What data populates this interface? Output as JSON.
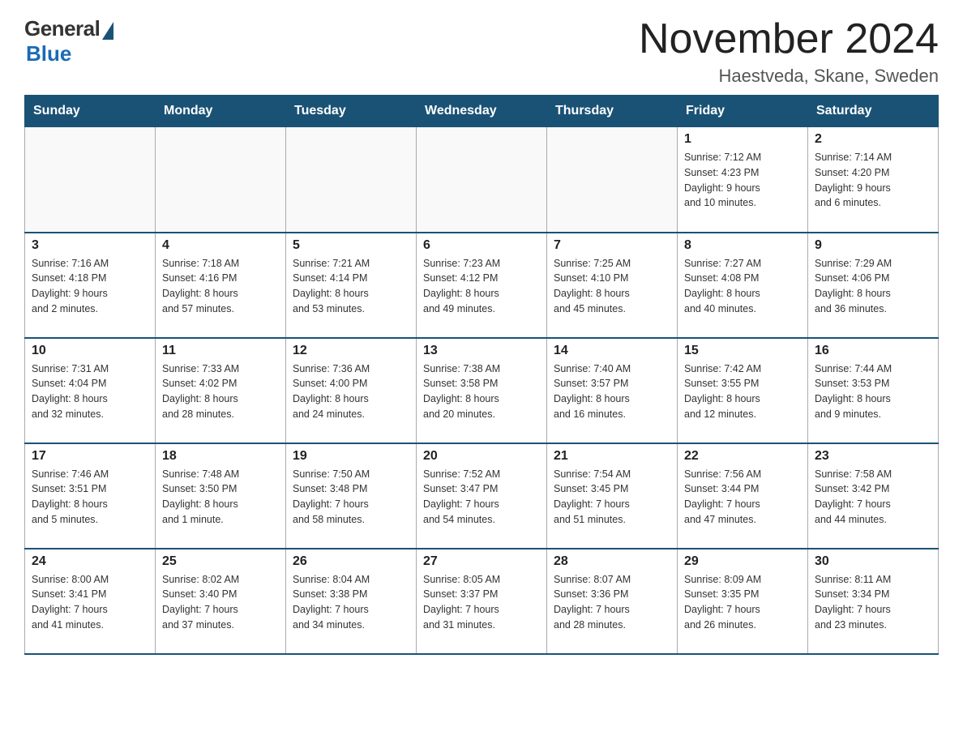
{
  "header": {
    "logo_general": "General",
    "logo_blue": "Blue",
    "month_year": "November 2024",
    "location": "Haestveda, Skane, Sweden"
  },
  "weekdays": [
    "Sunday",
    "Monday",
    "Tuesday",
    "Wednesday",
    "Thursday",
    "Friday",
    "Saturday"
  ],
  "weeks": [
    [
      {
        "day": "",
        "info": ""
      },
      {
        "day": "",
        "info": ""
      },
      {
        "day": "",
        "info": ""
      },
      {
        "day": "",
        "info": ""
      },
      {
        "day": "",
        "info": ""
      },
      {
        "day": "1",
        "info": "Sunrise: 7:12 AM\nSunset: 4:23 PM\nDaylight: 9 hours\nand 10 minutes."
      },
      {
        "day": "2",
        "info": "Sunrise: 7:14 AM\nSunset: 4:20 PM\nDaylight: 9 hours\nand 6 minutes."
      }
    ],
    [
      {
        "day": "3",
        "info": "Sunrise: 7:16 AM\nSunset: 4:18 PM\nDaylight: 9 hours\nand 2 minutes."
      },
      {
        "day": "4",
        "info": "Sunrise: 7:18 AM\nSunset: 4:16 PM\nDaylight: 8 hours\nand 57 minutes."
      },
      {
        "day": "5",
        "info": "Sunrise: 7:21 AM\nSunset: 4:14 PM\nDaylight: 8 hours\nand 53 minutes."
      },
      {
        "day": "6",
        "info": "Sunrise: 7:23 AM\nSunset: 4:12 PM\nDaylight: 8 hours\nand 49 minutes."
      },
      {
        "day": "7",
        "info": "Sunrise: 7:25 AM\nSunset: 4:10 PM\nDaylight: 8 hours\nand 45 minutes."
      },
      {
        "day": "8",
        "info": "Sunrise: 7:27 AM\nSunset: 4:08 PM\nDaylight: 8 hours\nand 40 minutes."
      },
      {
        "day": "9",
        "info": "Sunrise: 7:29 AM\nSunset: 4:06 PM\nDaylight: 8 hours\nand 36 minutes."
      }
    ],
    [
      {
        "day": "10",
        "info": "Sunrise: 7:31 AM\nSunset: 4:04 PM\nDaylight: 8 hours\nand 32 minutes."
      },
      {
        "day": "11",
        "info": "Sunrise: 7:33 AM\nSunset: 4:02 PM\nDaylight: 8 hours\nand 28 minutes."
      },
      {
        "day": "12",
        "info": "Sunrise: 7:36 AM\nSunset: 4:00 PM\nDaylight: 8 hours\nand 24 minutes."
      },
      {
        "day": "13",
        "info": "Sunrise: 7:38 AM\nSunset: 3:58 PM\nDaylight: 8 hours\nand 20 minutes."
      },
      {
        "day": "14",
        "info": "Sunrise: 7:40 AM\nSunset: 3:57 PM\nDaylight: 8 hours\nand 16 minutes."
      },
      {
        "day": "15",
        "info": "Sunrise: 7:42 AM\nSunset: 3:55 PM\nDaylight: 8 hours\nand 12 minutes."
      },
      {
        "day": "16",
        "info": "Sunrise: 7:44 AM\nSunset: 3:53 PM\nDaylight: 8 hours\nand 9 minutes."
      }
    ],
    [
      {
        "day": "17",
        "info": "Sunrise: 7:46 AM\nSunset: 3:51 PM\nDaylight: 8 hours\nand 5 minutes."
      },
      {
        "day": "18",
        "info": "Sunrise: 7:48 AM\nSunset: 3:50 PM\nDaylight: 8 hours\nand 1 minute."
      },
      {
        "day": "19",
        "info": "Sunrise: 7:50 AM\nSunset: 3:48 PM\nDaylight: 7 hours\nand 58 minutes."
      },
      {
        "day": "20",
        "info": "Sunrise: 7:52 AM\nSunset: 3:47 PM\nDaylight: 7 hours\nand 54 minutes."
      },
      {
        "day": "21",
        "info": "Sunrise: 7:54 AM\nSunset: 3:45 PM\nDaylight: 7 hours\nand 51 minutes."
      },
      {
        "day": "22",
        "info": "Sunrise: 7:56 AM\nSunset: 3:44 PM\nDaylight: 7 hours\nand 47 minutes."
      },
      {
        "day": "23",
        "info": "Sunrise: 7:58 AM\nSunset: 3:42 PM\nDaylight: 7 hours\nand 44 minutes."
      }
    ],
    [
      {
        "day": "24",
        "info": "Sunrise: 8:00 AM\nSunset: 3:41 PM\nDaylight: 7 hours\nand 41 minutes."
      },
      {
        "day": "25",
        "info": "Sunrise: 8:02 AM\nSunset: 3:40 PM\nDaylight: 7 hours\nand 37 minutes."
      },
      {
        "day": "26",
        "info": "Sunrise: 8:04 AM\nSunset: 3:38 PM\nDaylight: 7 hours\nand 34 minutes."
      },
      {
        "day": "27",
        "info": "Sunrise: 8:05 AM\nSunset: 3:37 PM\nDaylight: 7 hours\nand 31 minutes."
      },
      {
        "day": "28",
        "info": "Sunrise: 8:07 AM\nSunset: 3:36 PM\nDaylight: 7 hours\nand 28 minutes."
      },
      {
        "day": "29",
        "info": "Sunrise: 8:09 AM\nSunset: 3:35 PM\nDaylight: 7 hours\nand 26 minutes."
      },
      {
        "day": "30",
        "info": "Sunrise: 8:11 AM\nSunset: 3:34 PM\nDaylight: 7 hours\nand 23 minutes."
      }
    ]
  ]
}
